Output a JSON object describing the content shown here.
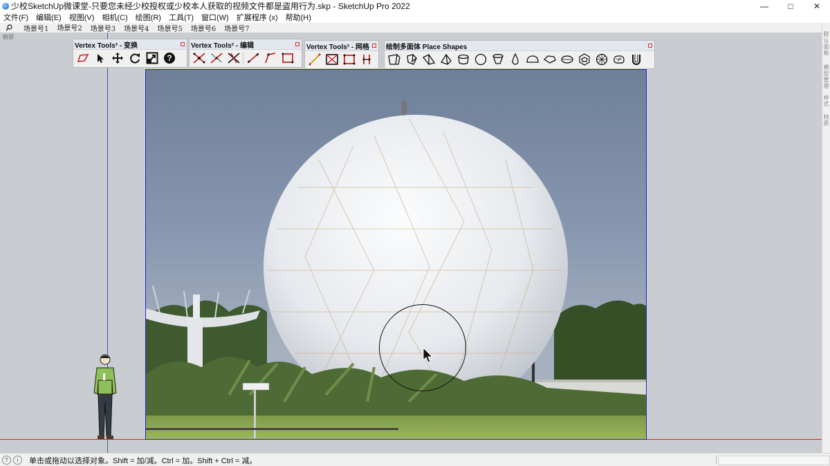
{
  "window": {
    "title": "少校SketchUp微课堂-只要您未经少校授权或少校本人获取的视频文件都是盗用行为.skp - SketchUp Pro 2022",
    "minimize": "—",
    "maximize": "□",
    "close": "✕"
  },
  "menu": [
    "文件(F)",
    "编辑(E)",
    "视图(V)",
    "相机(C)",
    "绘图(R)",
    "工具(T)",
    "窗口(W)",
    "扩展程序 (x)",
    "帮助(H)"
  ],
  "scenes": {
    "tabs": [
      "场景号1",
      "场景号2",
      "场景号3",
      "场景号4",
      "场景号5",
      "场景号6",
      "场景号7"
    ],
    "active_index": 1
  },
  "viewport": {
    "label": "俯部"
  },
  "toolbars": {
    "transform": {
      "title": "Vertex Tools² - 变换",
      "buttons": [
        "polygon-select-icon",
        "select-arrow-icon",
        "move-icon",
        "rotate-icon",
        "scale-icon",
        "help-icon"
      ]
    },
    "edit": {
      "title": "Vertex Tools² - 编辑",
      "buttons": [
        "merge-vertices-icon",
        "align-vertices-icon",
        "collapse-vertices-icon",
        "connect-line-icon",
        "bevel-corner-icon",
        "square-corners-icon"
      ]
    },
    "mesh": {
      "title": "Vertex Tools² - 网格",
      "buttons": [
        "diagonal-edge-icon",
        "cross-quad-icon",
        "quad-frame-icon",
        "split-edge-icon"
      ]
    },
    "place_shapes": {
      "title": "绘制多面体 Place Shapes",
      "buttons": [
        "box-shape-icon",
        "pentagon-prism-icon",
        "wedge-shape-icon",
        "pyramid-shape-icon",
        "cylinder-shape-icon",
        "sphere-shape-icon",
        "cone-shape-icon",
        "teardrop-shape-icon",
        "dome-shape-icon",
        "gem-shape-icon",
        "ellipse-shape-icon",
        "dodecahedron-icon",
        "geodesic-sphere-icon",
        "blob-shape-icon",
        "torus-u-icon"
      ]
    }
  },
  "tray": {
    "tabs": [
      "默认面板",
      "模型管理",
      "样式",
      "材质"
    ]
  },
  "status": {
    "info_icon": "?",
    "hint_icon": "i",
    "text": "单击或拖动以选择对象。Shift = 加/减。Ctrl = 加。Shift + Ctrl = 减。"
  },
  "colors": {
    "viewport_bg": "#c9ccd1",
    "axis_red": "#c03030",
    "axis_blue": "#3a3ab8",
    "photo_border": "#2222cc"
  }
}
